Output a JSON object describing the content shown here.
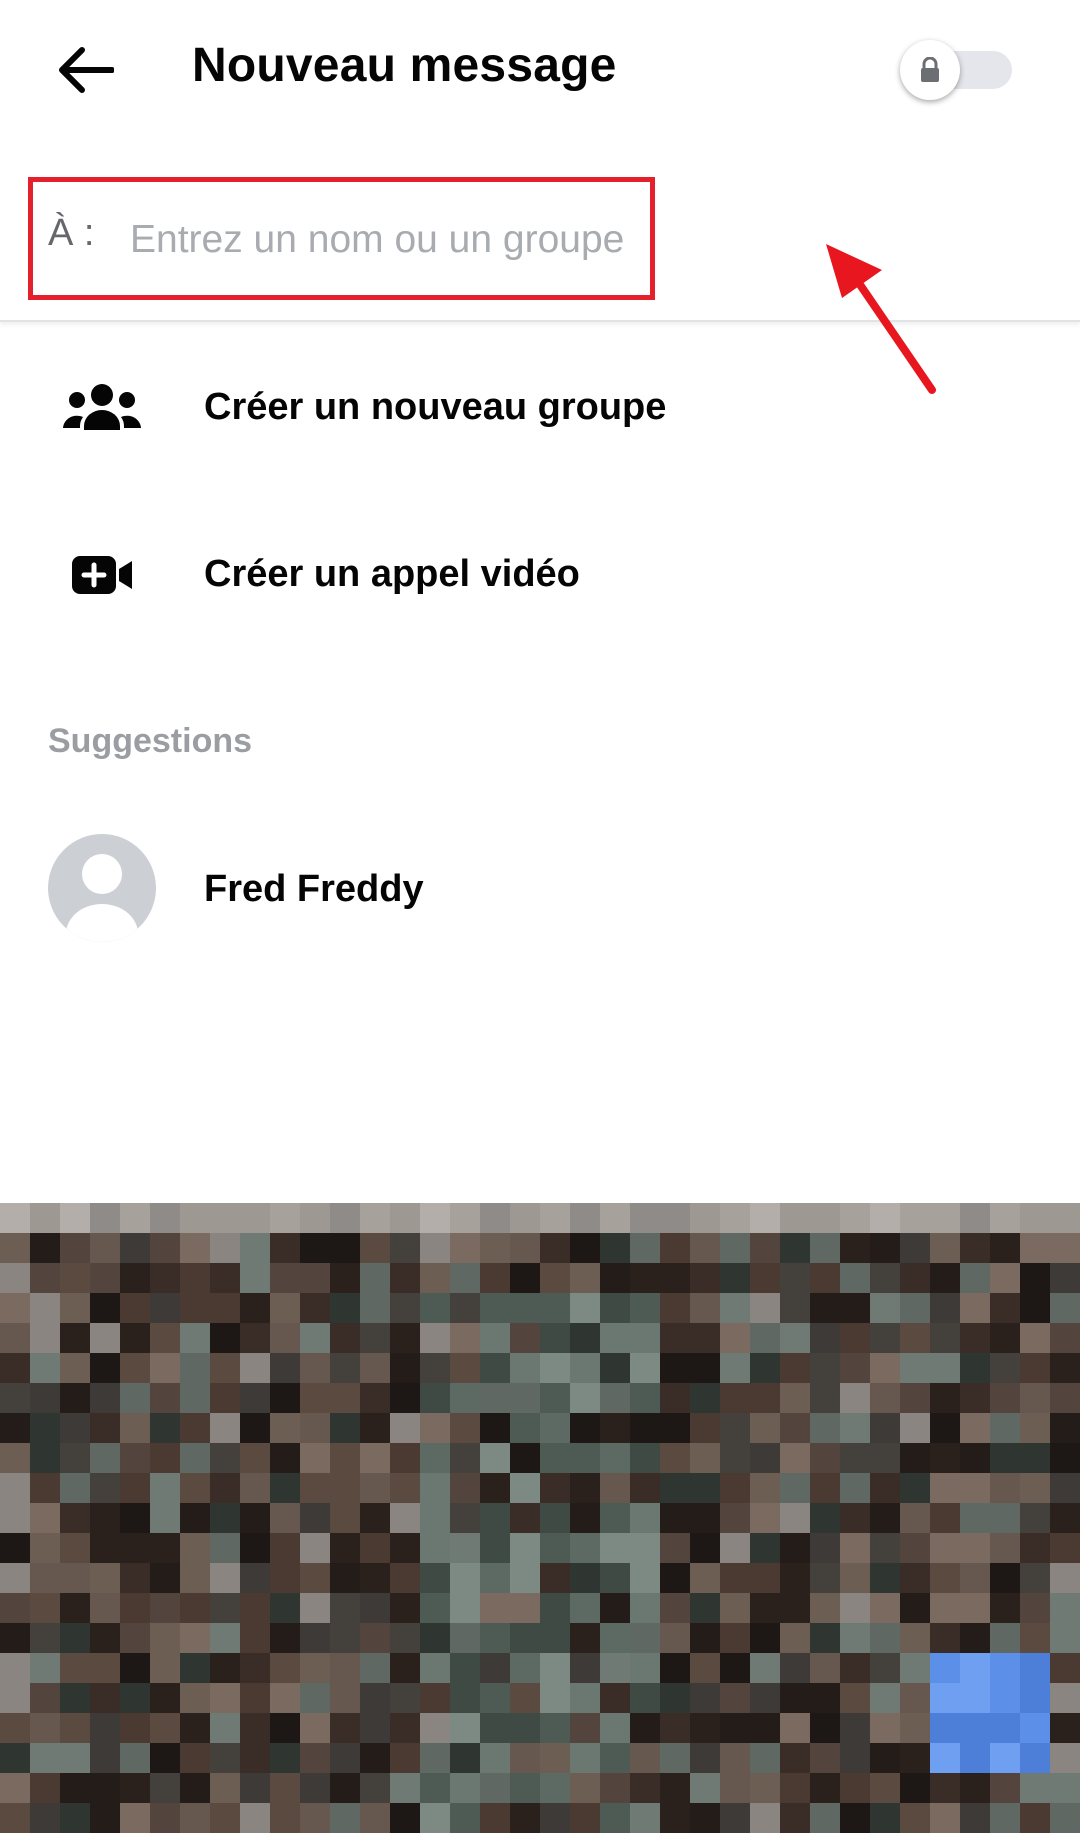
{
  "header": {
    "title": "Nouveau message",
    "back_icon": "arrow-left-icon",
    "secret_toggle": {
      "icon": "lock-icon",
      "on": false
    }
  },
  "recipient": {
    "label": "À :",
    "placeholder": "Entrez un nom ou un groupe",
    "value": ""
  },
  "actions": [
    {
      "label": "Créer un nouveau groupe",
      "icon": "group-icon"
    },
    {
      "label": "Créer un appel vidéo",
      "icon": "video-call-add-icon"
    }
  ],
  "suggestions": {
    "heading": "Suggestions",
    "items": [
      {
        "name": "Fred Freddy",
        "avatar": "default-avatar-icon"
      }
    ]
  },
  "colors": {
    "highlight": "#e3202b",
    "text_primary": "#050505",
    "text_secondary": "#65676b",
    "placeholder": "#a8abaf",
    "section_heading": "#9a9da2"
  }
}
